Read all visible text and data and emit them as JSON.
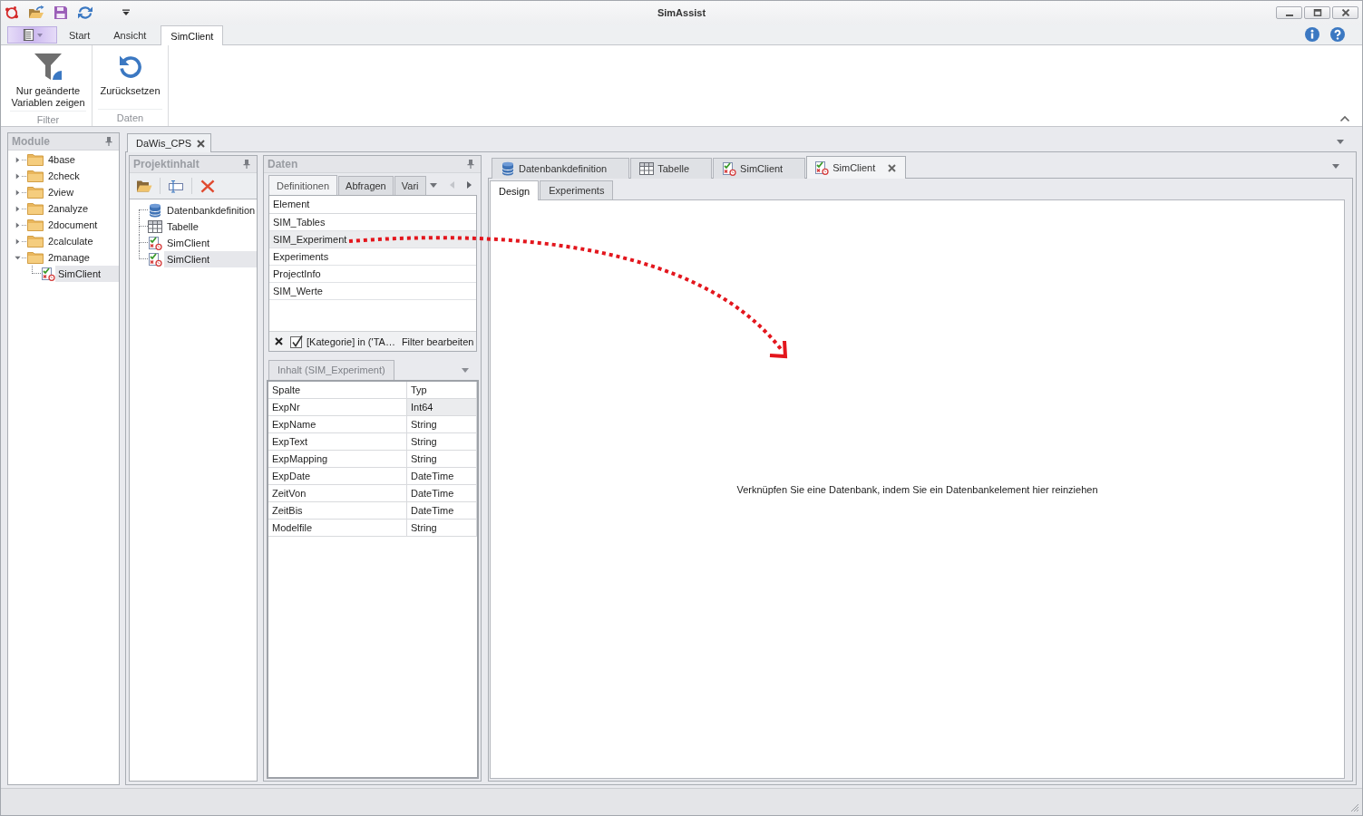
{
  "window": {
    "title": "SimAssist"
  },
  "ribbon": {
    "tabs": [
      {
        "label": "Start",
        "selected": false
      },
      {
        "label": "Ansicht",
        "selected": false
      },
      {
        "label": "SimClient",
        "selected": true
      }
    ],
    "groups": [
      {
        "label": "Filter",
        "buttons": [
          {
            "kind": "filter",
            "label": "Nur geänderte Variablen zeigen"
          }
        ]
      },
      {
        "label": "Daten",
        "buttons": [
          {
            "kind": "reset",
            "label": "Zurücksetzen"
          }
        ]
      }
    ]
  },
  "modules": {
    "title": "Module",
    "items": [
      {
        "label": "4base",
        "expanded": false,
        "selected": false
      },
      {
        "label": "2check",
        "expanded": false,
        "selected": false
      },
      {
        "label": "2view",
        "expanded": false,
        "selected": false
      },
      {
        "label": "2analyze",
        "expanded": false,
        "selected": false
      },
      {
        "label": "2document",
        "expanded": false,
        "selected": false
      },
      {
        "label": "2calculate",
        "expanded": false,
        "selected": false
      },
      {
        "label": "2manage",
        "expanded": true,
        "selected": false,
        "children": [
          {
            "kind": "simclient",
            "label": "SimClient",
            "selected": true
          }
        ]
      }
    ]
  },
  "document_tabs": [
    {
      "label": "DaWis_CPS",
      "selected": true
    }
  ],
  "project": {
    "title": "Projektinhalt",
    "items": [
      {
        "kind": "database",
        "label": "Datenbankdefinition",
        "selected": false
      },
      {
        "kind": "table",
        "label": "Tabelle",
        "selected": false
      },
      {
        "kind": "simclient",
        "label": "SimClient",
        "selected": false
      },
      {
        "kind": "simclient",
        "label": "SimClient",
        "selected": true
      }
    ]
  },
  "data": {
    "title": "Daten",
    "tabs": [
      {
        "label": "Definitionen",
        "selected": true
      },
      {
        "label": "Abfragen",
        "selected": false
      },
      {
        "label": "Vari",
        "selected": false
      }
    ],
    "column": "Element",
    "rows": [
      {
        "label": "SIM_Tables",
        "selected": false
      },
      {
        "label": "SIM_Experiment",
        "selected": true
      },
      {
        "label": "Experiments",
        "selected": false
      },
      {
        "label": "ProjectInfo",
        "selected": false
      },
      {
        "label": "SIM_Werte",
        "selected": false
      }
    ],
    "filter": {
      "checked": true,
      "text": "[Kategorie] in ('TA…",
      "action": "Filter bearbeiten"
    }
  },
  "content": {
    "tab": "Inhalt (SIM_Experiment)",
    "columns": [
      "Spalte",
      "Typ"
    ],
    "rows": [
      {
        "cells": [
          "ExpNr",
          "Int64"
        ],
        "selected": true
      },
      {
        "cells": [
          "ExpName",
          "String"
        ],
        "selected": false
      },
      {
        "cells": [
          "ExpText",
          "String"
        ],
        "selected": false
      },
      {
        "cells": [
          "ExpMapping",
          "String"
        ],
        "selected": false
      },
      {
        "cells": [
          "ExpDate",
          "DateTime"
        ],
        "selected": false
      },
      {
        "cells": [
          "ZeitVon",
          "DateTime"
        ],
        "selected": false
      },
      {
        "cells": [
          "ZeitBis",
          "DateTime"
        ],
        "selected": false
      },
      {
        "cells": [
          "Modelfile",
          "String"
        ],
        "selected": false
      }
    ]
  },
  "editor": {
    "tabs": [
      {
        "kind": "database",
        "label": "Datenbankdefinition",
        "selected": false
      },
      {
        "kind": "table",
        "label": "Tabelle",
        "selected": false
      },
      {
        "kind": "simclient",
        "label": "SimClient",
        "selected": false
      },
      {
        "kind": "simclient",
        "label": "SimClient",
        "selected": true
      }
    ],
    "subtabs": [
      {
        "label": "Design",
        "selected": true
      },
      {
        "label": "Experiments",
        "selected": false
      }
    ],
    "hint": "Verknüpfen Sie eine Datenbank, indem Sie ein Datenbankelement hier reinziehen"
  }
}
